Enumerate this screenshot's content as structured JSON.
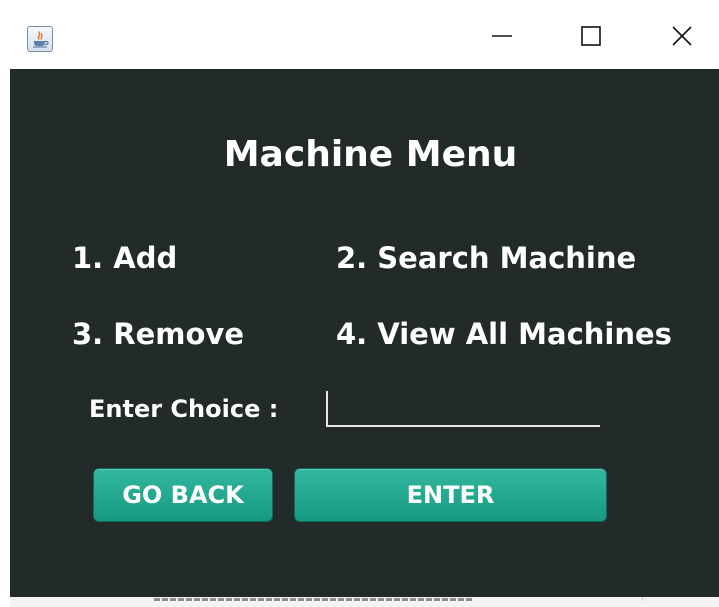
{
  "window": {
    "icon": "java-cup-icon",
    "controls": {
      "minimize": "minimize-icon",
      "maximize": "maximize-icon",
      "close": "close-icon"
    }
  },
  "menu": {
    "title": "Machine Menu",
    "items": [
      {
        "label": "1. Add"
      },
      {
        "label": "2. Search Machine"
      },
      {
        "label": "3. Remove"
      },
      {
        "label": "4. View All Machines"
      }
    ],
    "choice_label": "Enter Choice :",
    "choice_value": "",
    "go_back_label": "GO BACK",
    "enter_label": "ENTER"
  },
  "colors": {
    "background": "#232a2a",
    "button": "#1ea48b",
    "text": "#ffffff"
  }
}
